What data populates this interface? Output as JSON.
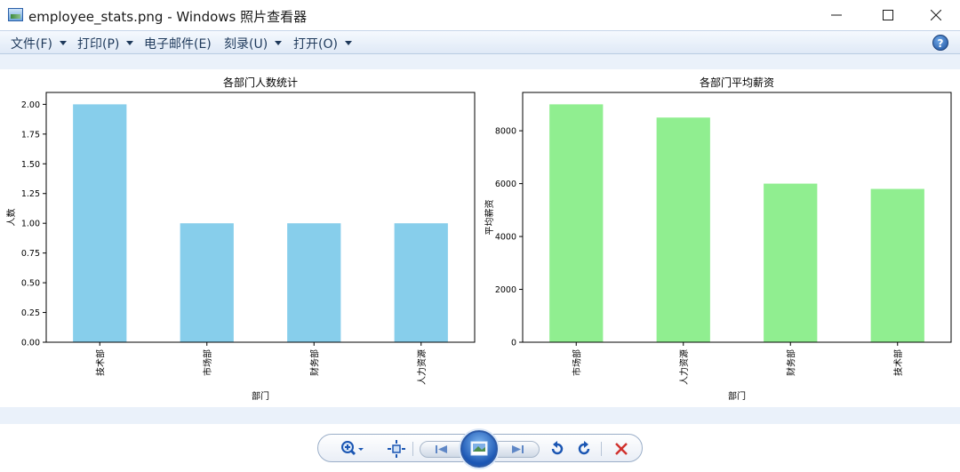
{
  "window": {
    "title": "employee_stats.png - Windows 照片查看器",
    "controls": {
      "minimize": "minimize",
      "maximize": "maximize",
      "close": "close"
    }
  },
  "menu": {
    "items": [
      {
        "label": "文件(F)",
        "dropdown": true
      },
      {
        "label": "打印(P)",
        "dropdown": true
      },
      {
        "label": "电子邮件(E)",
        "dropdown": false
      },
      {
        "label": "刻录(U)",
        "dropdown": true
      },
      {
        "label": "打开(O)",
        "dropdown": true
      }
    ],
    "help_icon": "help-icon",
    "help_glyph": "?"
  },
  "colors": {
    "bar_left": "#87ceeb",
    "bar_right": "#90ee90",
    "menu_text": "#1e395b",
    "toolbar_blue": "#1b56b3",
    "delete_red": "#d0312d"
  },
  "chart_data": [
    {
      "type": "bar",
      "title": "各部门人数统计",
      "xlabel": "部门",
      "ylabel": "人数",
      "categories": [
        "技术部",
        "市场部",
        "财务部",
        "人力资源"
      ],
      "values": [
        2,
        1,
        1,
        1
      ],
      "ylim": [
        0,
        2.1
      ],
      "yticks": [
        "0.00",
        "0.25",
        "0.50",
        "0.75",
        "1.00",
        "1.25",
        "1.50",
        "1.75",
        "2.00"
      ],
      "ytick_values": [
        0,
        0.25,
        0.5,
        0.75,
        1.0,
        1.25,
        1.5,
        1.75,
        2.0
      ],
      "color": "#87ceeb",
      "grid": false,
      "legend": "none"
    },
    {
      "type": "bar",
      "title": "各部门平均薪资",
      "xlabel": "部门",
      "ylabel": "平均薪资",
      "categories": [
        "市场部",
        "人力资源",
        "财务部",
        "技术部"
      ],
      "values": [
        9000,
        8500,
        6000,
        5800
      ],
      "ylim": [
        0,
        9450
      ],
      "yticks": [
        "0",
        "2000",
        "4000",
        "6000",
        "8000"
      ],
      "ytick_values": [
        0,
        2000,
        4000,
        6000,
        8000
      ],
      "color": "#90ee90",
      "grid": false,
      "legend": "none"
    }
  ],
  "toolbar": {
    "buttons": [
      {
        "name": "zoom-icon",
        "kind": "zoom"
      },
      {
        "name": "actual-size-icon",
        "kind": "fit"
      },
      {
        "name": "previous-icon",
        "kind": "prev"
      },
      {
        "name": "slideshow-icon",
        "kind": "slideshow"
      },
      {
        "name": "next-icon",
        "kind": "next"
      },
      {
        "name": "rotate-counterclockwise-icon",
        "kind": "rotl"
      },
      {
        "name": "rotate-clockwise-icon",
        "kind": "rotr"
      },
      {
        "name": "delete-icon",
        "kind": "delete"
      }
    ]
  }
}
